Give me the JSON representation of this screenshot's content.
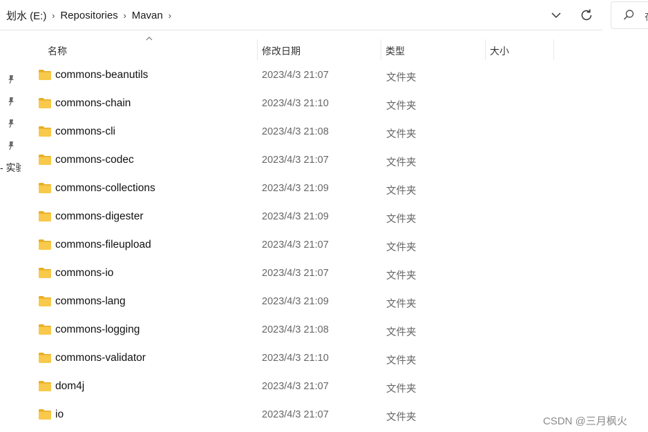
{
  "breadcrumb": {
    "items": [
      "划水 (E:)",
      "Repositories",
      "Mavan"
    ]
  },
  "search": {
    "placeholder": "在"
  },
  "nav": {
    "partial_label": "- 实验"
  },
  "columns": {
    "name": "名称",
    "date": "修改日期",
    "type": "类型",
    "size": "大小"
  },
  "files": [
    {
      "name": "commons-beanutils",
      "date": "2023/4/3 21:07",
      "type": "文件夹"
    },
    {
      "name": "commons-chain",
      "date": "2023/4/3 21:10",
      "type": "文件夹"
    },
    {
      "name": "commons-cli",
      "date": "2023/4/3 21:08",
      "type": "文件夹"
    },
    {
      "name": "commons-codec",
      "date": "2023/4/3 21:07",
      "type": "文件夹"
    },
    {
      "name": "commons-collections",
      "date": "2023/4/3 21:09",
      "type": "文件夹"
    },
    {
      "name": "commons-digester",
      "date": "2023/4/3 21:09",
      "type": "文件夹"
    },
    {
      "name": "commons-fileupload",
      "date": "2023/4/3 21:07",
      "type": "文件夹"
    },
    {
      "name": "commons-io",
      "date": "2023/4/3 21:07",
      "type": "文件夹"
    },
    {
      "name": "commons-lang",
      "date": "2023/4/3 21:09",
      "type": "文件夹"
    },
    {
      "name": "commons-logging",
      "date": "2023/4/3 21:08",
      "type": "文件夹"
    },
    {
      "name": "commons-validator",
      "date": "2023/4/3 21:10",
      "type": "文件夹"
    },
    {
      "name": "dom4j",
      "date": "2023/4/3 21:07",
      "type": "文件夹"
    },
    {
      "name": "io",
      "date": "2023/4/3 21:07",
      "type": "文件夹"
    }
  ],
  "watermark": "CSDN @三月枫火",
  "colors": {
    "folder": "#f8c94a",
    "folder_dark": "#e8ad20",
    "muted_text": "#666666"
  }
}
